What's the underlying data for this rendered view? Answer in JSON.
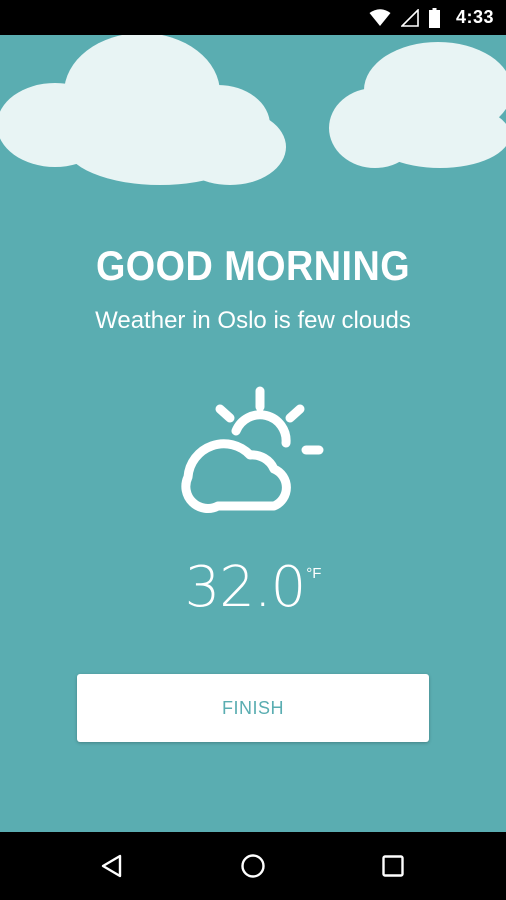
{
  "status_bar": {
    "time": "4:33",
    "icons": [
      "wifi-icon",
      "cell-signal-icon",
      "battery-icon"
    ]
  },
  "main": {
    "greeting": "GOOD MORNING",
    "subtitle": "Weather in Oslo is few clouds",
    "weather_icon": "partly-cloudy-icon",
    "temperature": "32.0",
    "temperature_unit": "°F",
    "finish_label": "FINISH"
  },
  "nav_bar": {
    "buttons": [
      "back-icon",
      "home-icon",
      "recents-icon"
    ]
  },
  "colors": {
    "background": "#5aadb1",
    "accent": "#5aadb1",
    "cloud": "#e8f4f4",
    "button": "#ffffff"
  }
}
